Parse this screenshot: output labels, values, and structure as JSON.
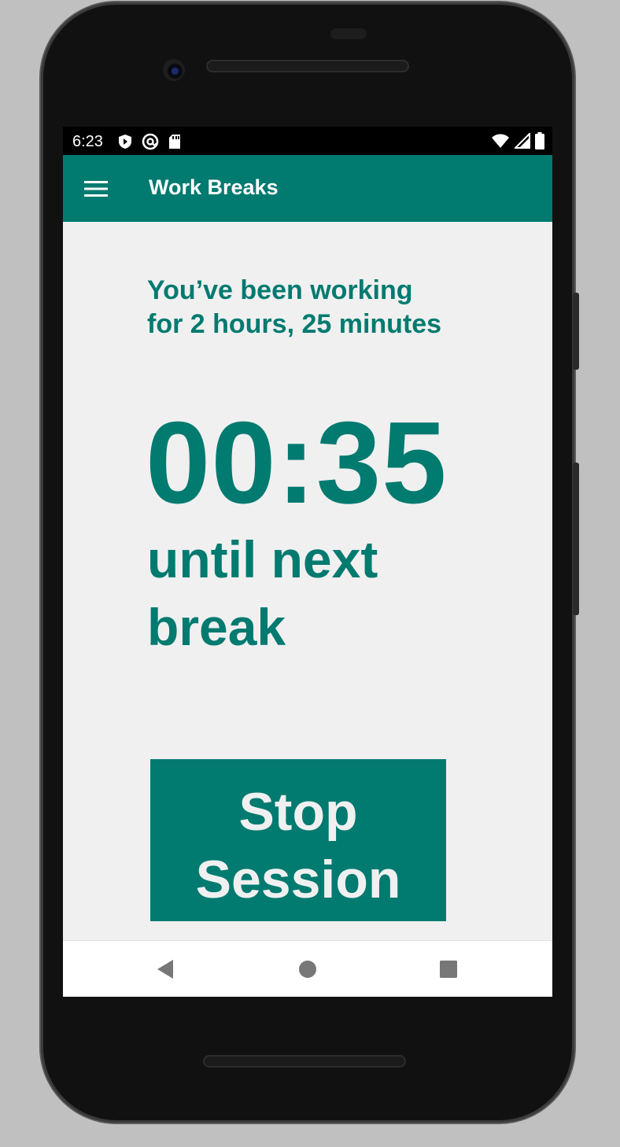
{
  "status_bar": {
    "time": "6:23",
    "left_icons": [
      "shield-icon",
      "at-sign-icon",
      "sd-card-icon"
    ],
    "right_icons": [
      "wifi-icon",
      "cell-signal-icon",
      "battery-icon"
    ]
  },
  "app_bar": {
    "title": "Work Breaks",
    "menu_icon": "hamburger-menu-icon",
    "background_color": "#017a70"
  },
  "main": {
    "working_line1": "You’ve been working",
    "working_line2": "for 2 hours, 25 minutes",
    "countdown": "00:35",
    "until_line1": "until next",
    "until_line2": "break",
    "text_color": "#017a70"
  },
  "stop_button": {
    "line1": "Stop",
    "line2": "Session"
  },
  "nav_bar": {
    "buttons": [
      "back-icon",
      "home-icon",
      "recents-icon"
    ]
  }
}
